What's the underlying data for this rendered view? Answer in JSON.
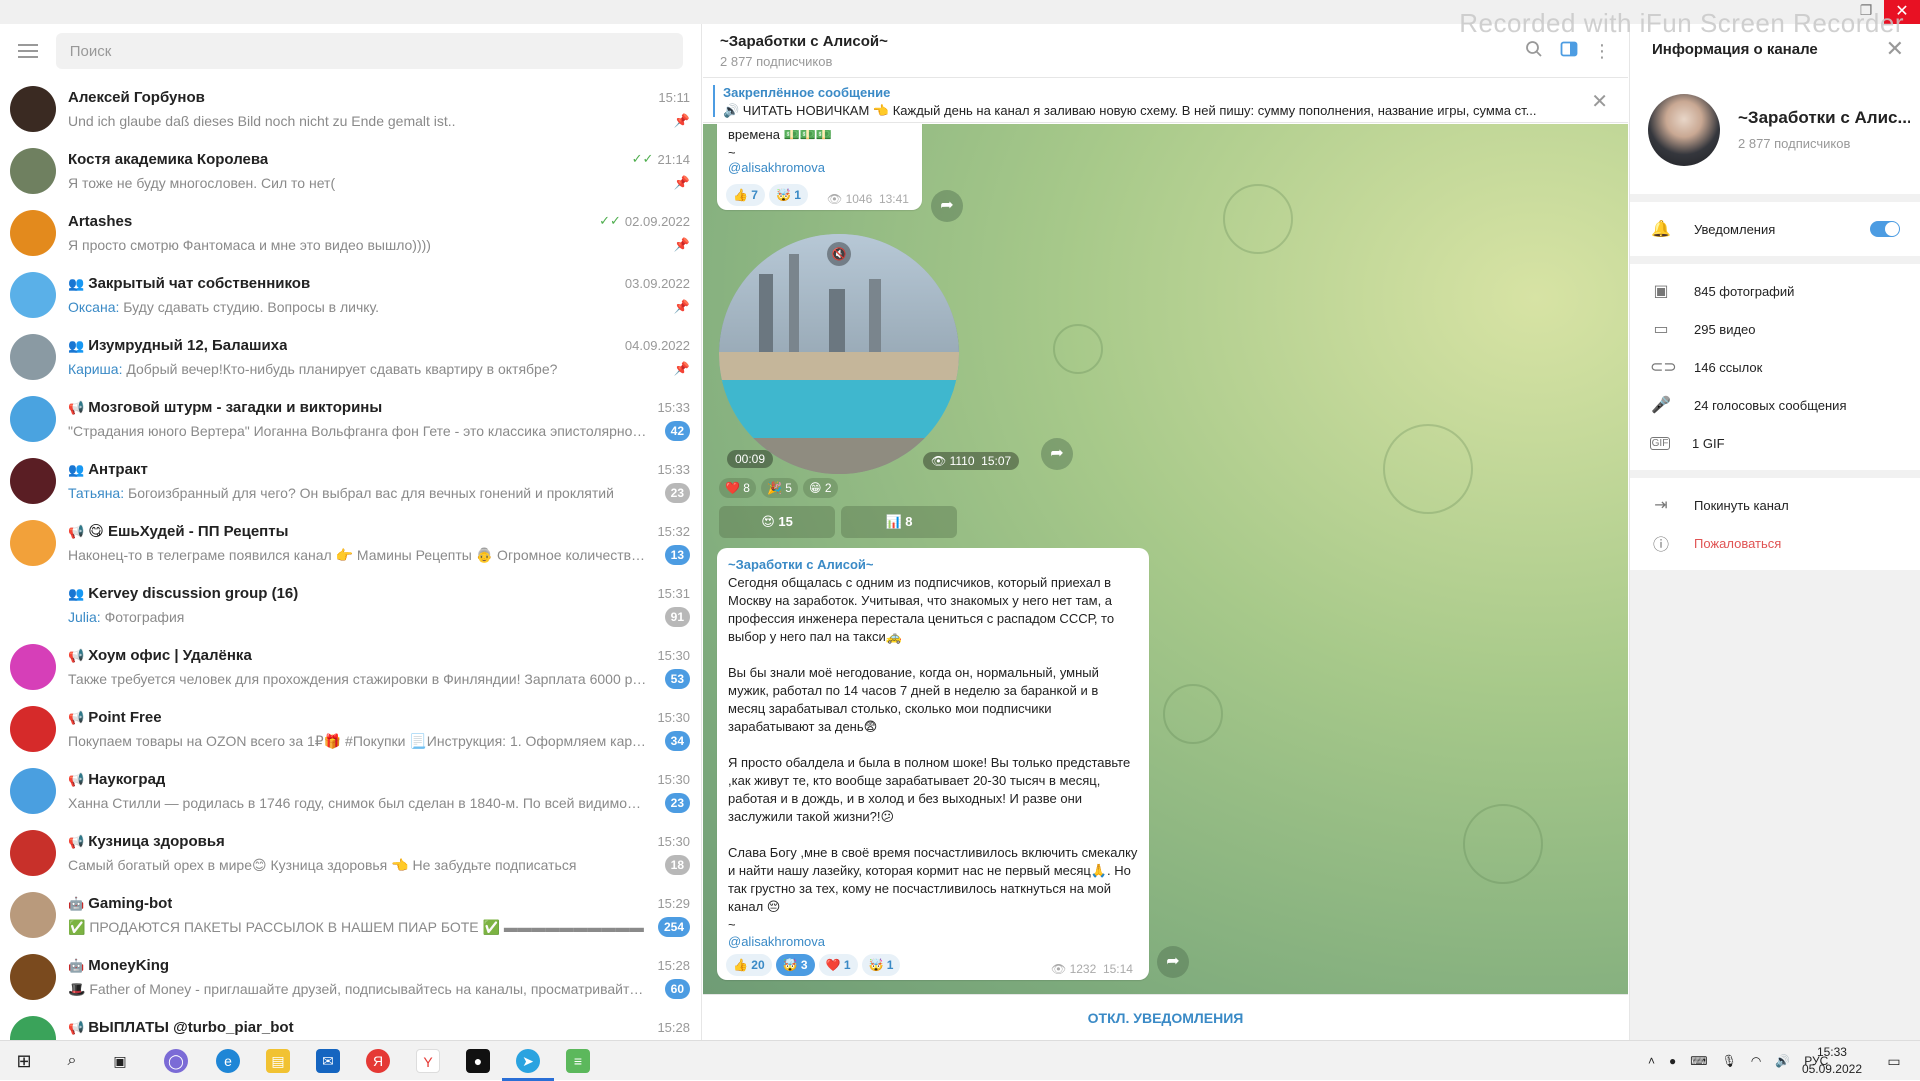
{
  "watermark": "Recorded with iFun Screen Recorder",
  "search": {
    "placeholder": "Поиск"
  },
  "chats": [
    {
      "name": "Алексей Горбунов",
      "time": "15:11",
      "preview": "Und ich glaube daß dieses Bild noch nicht zu Ende gemalt ist..",
      "pinned": true,
      "avatar_color": "#3a2a22"
    },
    {
      "name": "Костя академика Королева",
      "time": "21:14",
      "preview": "Я тоже не буду многословен. Сил то нет(",
      "pinned": true,
      "read": true,
      "avatar_color": "#6f8060"
    },
    {
      "name": "Artashes",
      "time": "02.09.2022",
      "preview": "Я просто смотрю Фантомаса и мне это видео вышло))))",
      "pinned": true,
      "read": true,
      "avatar_color": "#e38a1d"
    },
    {
      "name": "Закрытый чат собственников",
      "time": "03.09.2022",
      "sender": "Оксана:",
      "preview": "Буду сдавать студию. Вопросы в личку.",
      "pinned": true,
      "group": true,
      "avatar_color": "#5ab0e8"
    },
    {
      "name": "Изумрудный 12, Балашиха",
      "time": "04.09.2022",
      "sender": "Кариша:",
      "preview": "Добрый вечер!Кто-нибудь планирует сдавать квартиру в октябре?",
      "pinned": true,
      "group": true,
      "avatar_color": "#8a9aa3"
    },
    {
      "name": "Мозговой штурм - загадки и викторины",
      "time": "15:33",
      "preview": "\"Страдания юного Вертера\" Иоганна Вольфганга фон Гете - это классика эпистолярного жанр...",
      "badge": "42",
      "channel": true,
      "avatar_color": "#4aa3e0"
    },
    {
      "name": "Антракт",
      "time": "15:33",
      "sender": "Татьяна:",
      "preview": "Богоизбранный для чего? Он выбрал вас для вечных гонений и проклятий",
      "badge": "23",
      "muted": true,
      "group": true,
      "avatar_color": "#5a1e24"
    },
    {
      "name": "😋 ЕшьХудей - ПП Рецепты",
      "time": "15:32",
      "preview": "Наконец-то в телеграме появился канал 👉 Мамины Рецепты 👵 Огромное количество ...",
      "badge": "13",
      "channel": true,
      "avatar_color": "#f2a13a"
    },
    {
      "name": "Kervey discussion group  (16)",
      "time": "15:31",
      "sender": "Julia:",
      "preview": "Фотография",
      "badge": "91",
      "muted": true,
      "group": true,
      "avatar_color": "#ffffff"
    },
    {
      "name": "Хоум офис | Удалёнка",
      "time": "15:30",
      "preview": "Также требуется человек для прохождения стажировки в Финляндии! Зарплата 6000 руб/ден...",
      "badge": "53",
      "channel": true,
      "avatar_color": "#d63fb8"
    },
    {
      "name": "Point Free",
      "time": "15:30",
      "preview": "Покупаем товары на OZON  всего за 1₽🎁 #Покупки  📃Инструкция:  1. Оформляем карт...",
      "badge": "34",
      "channel": true,
      "avatar_color": "#d62a2a"
    },
    {
      "name": "Наукоград",
      "time": "15:30",
      "preview": "Ханна Стилли — родилась в 1746 году, снимок был сделан в 1840-м. По всей видимости, эта...",
      "badge": "23",
      "channel": true,
      "avatar_color": "#4a9fe0"
    },
    {
      "name": "Кузница здоровья",
      "time": "15:30",
      "preview": "Самый богатый орех в мире😊  Кузница здоровья 👈 Не забудьте подписаться",
      "badge": "18",
      "muted": true,
      "channel": true,
      "avatar_color": "#c8302a"
    },
    {
      "name": "Gaming-bot",
      "time": "15:29",
      "preview": "✅ ПРОДАЮТСЯ ПАКЕТЫ РАССЫЛОК  В НАШЕМ ПИАР БОТЕ ✅ ▬▬▬▬▬▬▬▬▬▬",
      "badge": "254",
      "bot": true,
      "avatar_color": "#b99a7c"
    },
    {
      "name": "MoneyKing",
      "time": "15:28",
      "preview": "🎩 Father of Money - приглашайте друзей, подписывайтесь на каналы, просматривайте в...",
      "badge": "60",
      "bot": true,
      "avatar_color": "#7a4a1e"
    },
    {
      "name": "ВЫПЛАТЫ @turbo_piar_bot",
      "time": "15:28",
      "preview": "",
      "channel": true,
      "avatar_color": "#3aa35a"
    }
  ],
  "header": {
    "title": "~Заработки с Алисой~",
    "subtitle": "2 877 подписчиков"
  },
  "pinned": {
    "title": "Закреплённое сообщение",
    "text": "🔊 ЧИТАТЬ НОВИЧКАМ 👈  Каждый день на канал я заливаю новую схему. В ней пишу: сумму пополнения, название игры, сумма ст..."
  },
  "messages": {
    "m1": {
      "text": "времена 💵💵💵\n  ~",
      "link": "@alisakhromova",
      "reactions": [
        "👍 7",
        "🤯 1"
      ],
      "views": "1046",
      "time": "13:41"
    },
    "m2": {
      "duration": "00:09",
      "views": "1110",
      "time": "15:07",
      "reactions": [
        "❤️ 8",
        "🎉 5",
        "😁 2"
      ],
      "buttons": [
        "😍 15",
        "📊 8"
      ]
    },
    "m3": {
      "author": "~Заработки с Алисой~",
      "text": "Сегодня общалась с одним из подписчиков, который приехал в Москву на заработок. Учитывая, что знакомых у него нет там, а профессия инженера перестала цениться с распадом СССР, то выбор у него пал на такси🚕\n\nВы бы знали моё негодование, когда он, нормальный, умный мужик, работал по 14 часов 7 дней в неделю за баранкой и в месяц зарабатывал столько, сколько мои подписчики зарабатывают за день😨\n\nЯ просто обалдела и была в полном шоке! Вы только представьте ,как живут те, кто вообще зарабатывает 20-30 тысяч в месяц, работая и в дождь, и в холод и без выходных! И разве они заслужили такой жизни?!😕\n\nСлава Богу ,мне в своё время посчастливилось включить смекалку и найти нашу лазейку, которая кормит нас не первый месяц🙏. Но так грустно за тех, кому не посчастливилось наткнуться на мой канал 😔\n  ~",
      "link": "@alisakhromova",
      "reactions": [
        "👍 20",
        "🤯 3",
        "❤️ 1",
        "🤯 1"
      ],
      "views": "1232",
      "time": "15:14"
    }
  },
  "footer": {
    "label": "ОТКЛ. УВЕДОМЛЕНИЯ"
  },
  "info": {
    "title": "Информация о канале",
    "name": "~Заработки с Алис...",
    "subscribers": "2 877 подписчиков",
    "notifications": "Уведомления",
    "media": [
      "845 фотографий",
      "295 видео",
      "146 ссылок",
      "24 голосовых сообщения",
      "1 GIF"
    ],
    "leave": "Покинуть канал",
    "report": "Пожаловаться"
  },
  "taskbar": {
    "lang": "РУС",
    "time": "15:33",
    "date": "05.09.2022"
  },
  "colors": {
    "accent": "#4c9ce2",
    "link": "#3a8ac6",
    "danger": "#e05353"
  }
}
